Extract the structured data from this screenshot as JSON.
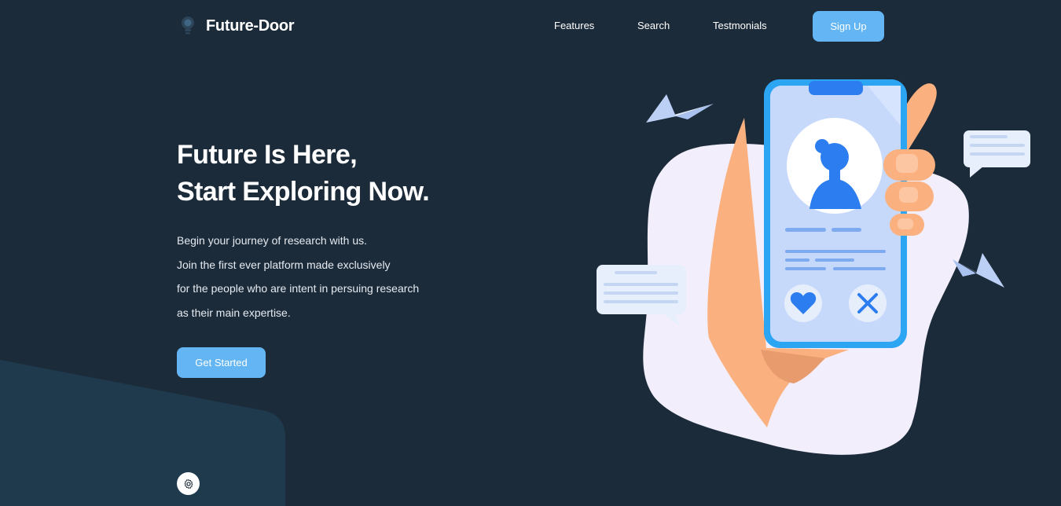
{
  "header": {
    "brand": {
      "name": "Future-Door",
      "icon": "lightbulb-icon"
    },
    "nav": [
      {
        "label": "Features"
      },
      {
        "label": "Search"
      },
      {
        "label": "Testmonials"
      }
    ],
    "signup_label": "Sign Up"
  },
  "hero": {
    "title_lines": [
      "Future Is Here,",
      "Start Exploring Now."
    ],
    "description_lines": [
      "Begin your journey of research with us.",
      "Join the first ever platform made exclusively",
      "for the people who are intent in persuing research",
      "as their main expertise."
    ],
    "cta_label": "Get Started"
  },
  "settings": {
    "icon": "gear-icon"
  },
  "illustration": {
    "description_icons": [
      "hand-icon",
      "phone-icon",
      "profile-avatar-icon",
      "heart-icon",
      "close-icon",
      "paper-plane-icon",
      "chat-bubble-icon"
    ]
  },
  "colors": {
    "background": "#1c2b3a",
    "accent": "#63b6f3",
    "panel": "#1f3a4d",
    "blob": "#f2eefc",
    "hand": "#fbb17f",
    "phone_blue": "#2c7df0"
  }
}
